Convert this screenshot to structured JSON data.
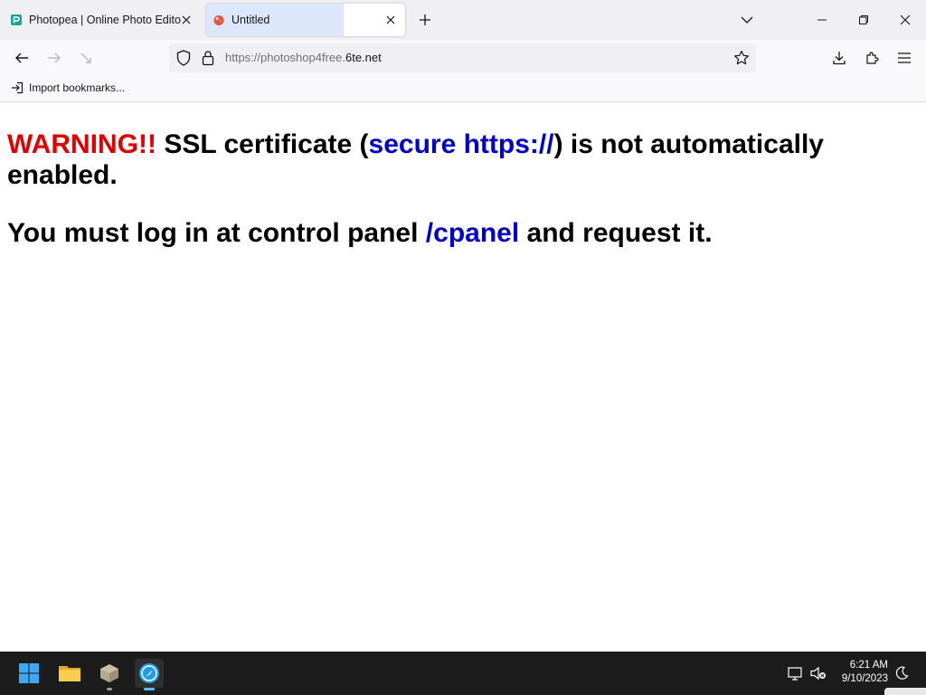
{
  "browser": {
    "tabs": [
      {
        "title": "Photopea | Online Photo Editor",
        "favicon": "photopea-icon",
        "active": false
      },
      {
        "title": "Untitled",
        "favicon": "red-blob-icon",
        "active": true
      }
    ],
    "url": {
      "prefix": "https://photoshop4free.",
      "domain": "6te.net"
    },
    "bookmarks": [
      {
        "label": "Import bookmarks...",
        "icon": "import-icon"
      }
    ]
  },
  "page": {
    "line1": {
      "warning": "WARNING!!",
      "text_a": " SSL certificate (",
      "link": "secure https://",
      "text_b": ") is not automatically enabled."
    },
    "line2": {
      "text_a": "You must log in at control panel ",
      "link": "/cpanel",
      "text_b": " and request it."
    },
    "colors": {
      "warning": "#e00000",
      "link": "#0000cc"
    }
  },
  "taskbar": {
    "apps": [
      {
        "name": "start-icon"
      },
      {
        "name": "file-explorer-icon"
      },
      {
        "name": "package-app-icon"
      },
      {
        "name": "browser-app-icon",
        "active": true
      }
    ],
    "clock": {
      "time": "6:21 AM",
      "date": "9/10/2023"
    }
  }
}
